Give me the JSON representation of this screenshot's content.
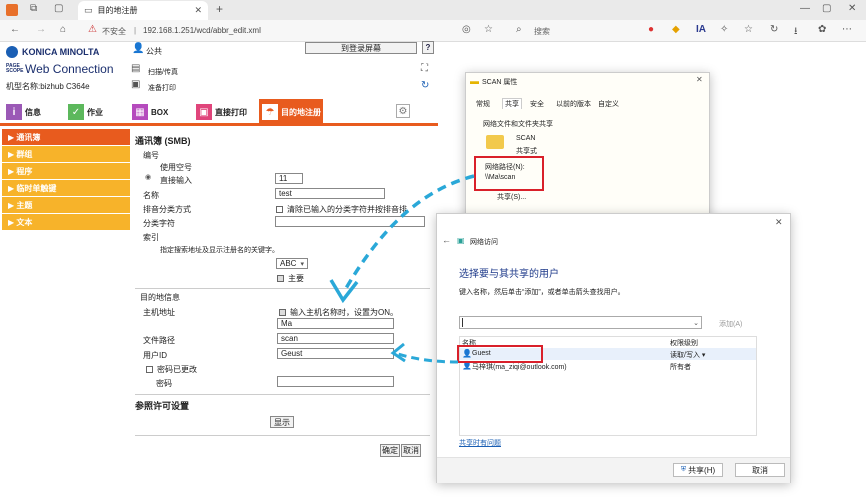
{
  "browser": {
    "tab_title": "目的地注册",
    "address_warning": "不安全",
    "url": "192.168.1.251/wcd/abbr_edit.xml",
    "search_label": "搜索"
  },
  "brand": {
    "maker": "KONICA MINOLTA",
    "pagescope": "PAGE SCOPE",
    "product": "Web Connection",
    "model_label": "机型名称:bizhub C364e"
  },
  "header": {
    "public_label": "公共",
    "to_login": "到登录屏幕",
    "help": "?",
    "scan_fax": "扫描/传真",
    "print_ready": "准备打印"
  },
  "main_tabs": [
    {
      "label": "信息",
      "color": "#9b59b6"
    },
    {
      "label": "作业",
      "color": "#5cb85c"
    },
    {
      "label": "BOX",
      "color": "#b54bbd"
    },
    {
      "label": "直接打印",
      "color": "#e0457b"
    },
    {
      "label": "目的地注册",
      "color": "#e85b1e"
    }
  ],
  "sidebar": [
    {
      "label": "通讯簿",
      "active": true
    },
    {
      "label": "群组",
      "active": false
    },
    {
      "label": "程序",
      "active": false
    },
    {
      "label": "临时单触键",
      "active": false
    },
    {
      "label": "主题",
      "active": false
    },
    {
      "label": "文本",
      "active": false
    }
  ],
  "form": {
    "title": "通讯簿 (SMB)",
    "number_label": "编号",
    "use_free": "使用空号",
    "direct_input": "直接输入",
    "number_value": "11",
    "name_label": "名称",
    "name_value": "test",
    "sort_label": "排音分类方式",
    "sort_clear": "清除已输入的分类字符并按排音排",
    "sort_char_label": "分类字符",
    "index_label": "索引",
    "index_hint": "指定搜索地址及显示注册名的关键字。",
    "index_value": "ABC",
    "main_label": "主要",
    "dest_info": "目的地信息",
    "host_label": "主机地址",
    "host_check": "输入主机名称时，设置为ON。",
    "host_value": "Ma",
    "path_label": "文件路径",
    "path_value": "scan",
    "user_label": "用户ID",
    "user_value": "Geust",
    "pwd_changed": "密码已更改",
    "pwd_label": "密码",
    "ref_title": "参照许可设置",
    "show_btn": "显示",
    "ok_btn": "确定",
    "cancel_btn": "取消"
  },
  "props": {
    "title": "SCAN 属性",
    "tabs": [
      "常规",
      "共享",
      "安全",
      "以前的版本",
      "自定义"
    ],
    "section": "网络文件和文件夹共享",
    "folder": "SCAN",
    "shared": "共享式",
    "netpath_label": "网络路径(N):",
    "netpath_value": "\\\\Ma\\scan",
    "share_btn": "共享(S)..."
  },
  "net": {
    "title": "网络访问",
    "heading": "选择要与其共享的用户",
    "hint": "键入名称，然后单击“添加”，或者单击箭头查找用户。",
    "add_btn": "添加(A)",
    "col_name": "名称",
    "col_perm": "权限级别",
    "rows": [
      {
        "name": "Guest",
        "perm": "读取/写入 ▾"
      },
      {
        "name": "马梓琪(ma_ziqi@outlook.com)",
        "perm": "所有者"
      }
    ],
    "trouble": "共享时有问题",
    "share_btn": "共享(H)",
    "cancel_btn": "取消"
  }
}
